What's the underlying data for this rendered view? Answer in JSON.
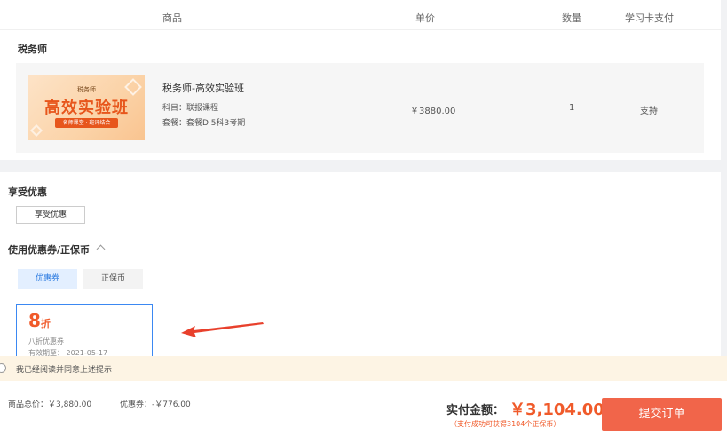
{
  "table_header": {
    "product": "商品",
    "unit_price": "单价",
    "quantity": "数量",
    "study_card": "学习卡支付"
  },
  "section": {
    "title": "税务师"
  },
  "product": {
    "thumb_small": "税务师",
    "thumb_big": "高效实验班",
    "thumb_tag": "名师课堂 · 班评结合",
    "name": "税务师-高效实验班",
    "subject": "科目：联报课程",
    "package": "套餐：套餐D 5科3考期",
    "price": "￥3880.00",
    "quantity": "1",
    "study_card": "支持"
  },
  "benefits": {
    "title": "享受优惠",
    "button": "享受优惠"
  },
  "coupons": {
    "title": "使用优惠券/正保币",
    "tab_coupon": "优惠券",
    "tab_coin": "正保币",
    "card": {
      "discount_num": "8",
      "discount_unit": "折",
      "desc": "八折优惠券",
      "expiry": "有效期至：  2021-05-17"
    }
  },
  "agreement": {
    "text": "我已经阅读并同意上述提示"
  },
  "footer": {
    "total": "商品总价：￥3,880.00",
    "coupon": "优惠券：-￥776.00",
    "pay_label": "实付金额：",
    "pay_amount": "￥3,104.00",
    "pay_note": "（支付成功可获得3104个正保币）",
    "submit": "提交订单"
  },
  "colors": {
    "accent_orange": "#f05a2a",
    "submit_bg": "#f1654a",
    "coupon_border": "#3b88f2",
    "tab_active_bg": "#e3efff",
    "agreement_bg": "#fdf4e4"
  }
}
